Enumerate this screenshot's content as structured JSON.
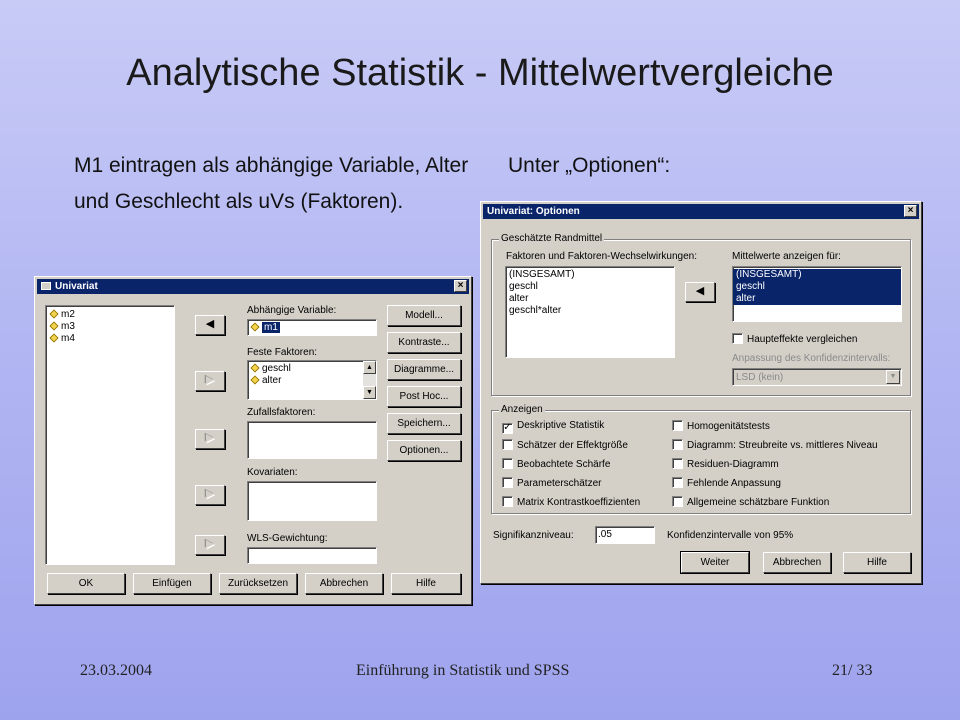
{
  "slide": {
    "title": "Analytische Statistik - Mittelwertvergleiche",
    "bullet_left": "M1 eintragen als abhängige Variable, Alter und Geschlecht als uVs (Faktoren).",
    "bullet_right": "Unter „Optionen“:",
    "footer_date": "23.03.2004",
    "footer_title": "Einführung in Statistik und SPSS",
    "footer_page": "21/ 33"
  },
  "univariat": {
    "title": "Univariat",
    "close": "×",
    "variables": [
      "m2",
      "m3",
      "m4"
    ],
    "dependent_label": "Abhängige Variable:",
    "dependent_value": "m1",
    "fixed_factors_label": "Feste Faktoren:",
    "fixed_factors": [
      "geschl",
      "alter"
    ],
    "random_factors_label": "Zufallsfaktoren:",
    "covariates_label": "Kovariaten:",
    "wls_label": "WLS-Gewichtung:",
    "side_buttons": [
      "Modell...",
      "Kontraste...",
      "Diagramme...",
      "Post Hoc...",
      "Speichern...",
      "Optionen..."
    ],
    "bottom_buttons": [
      "OK",
      "Einfügen",
      "Zurücksetzen",
      "Abbrechen",
      "Hilfe"
    ],
    "arrow_left": "◀",
    "arrow_right": "▶"
  },
  "optionen": {
    "title": "Univariat: Optionen",
    "close": "×",
    "group_marginal": "Geschätzte Randmittel",
    "factors_label": "Faktoren und Faktoren-Wechselwirkungen:",
    "factors": [
      "(INSGESAMT)",
      "geschl",
      "alter",
      "geschl*alter"
    ],
    "means_label": "Mittelwerte anzeigen für:",
    "means": [
      "(INSGESAMT)",
      "geschl",
      "alter"
    ],
    "main_effects": "Haupteffekte vergleichen",
    "ci_adjust_label": "Anpassung des Konfidenzintervalls:",
    "ci_adjust_value": "LSD (kein)",
    "group_display": "Anzeigen",
    "display_left": [
      {
        "label": "Deskriptive Statistik",
        "checked": "✓"
      },
      {
        "label": "Schätzer der Effektgröße",
        "checked": ""
      },
      {
        "label": "Beobachtete Schärfe",
        "checked": ""
      },
      {
        "label": "Parameterschätzer",
        "checked": ""
      },
      {
        "label": "Matrix Kontrastkoeffizienten",
        "checked": ""
      }
    ],
    "display_right": [
      {
        "label": "Homogenitätstests",
        "checked": ""
      },
      {
        "label": "Diagramm: Streubreite vs. mittleres Niveau",
        "checked": ""
      },
      {
        "label": "Residuen-Diagramm",
        "checked": ""
      },
      {
        "label": "Fehlende Anpassung",
        "checked": ""
      },
      {
        "label": "Allgemeine schätzbare Funktion",
        "checked": ""
      }
    ],
    "significance_label": "Signifikanzniveau:",
    "significance_value": ".05",
    "ci_text": "Konfidenzintervalle von 95%",
    "buttons": [
      "Weiter",
      "Abbrechen",
      "Hilfe"
    ]
  }
}
